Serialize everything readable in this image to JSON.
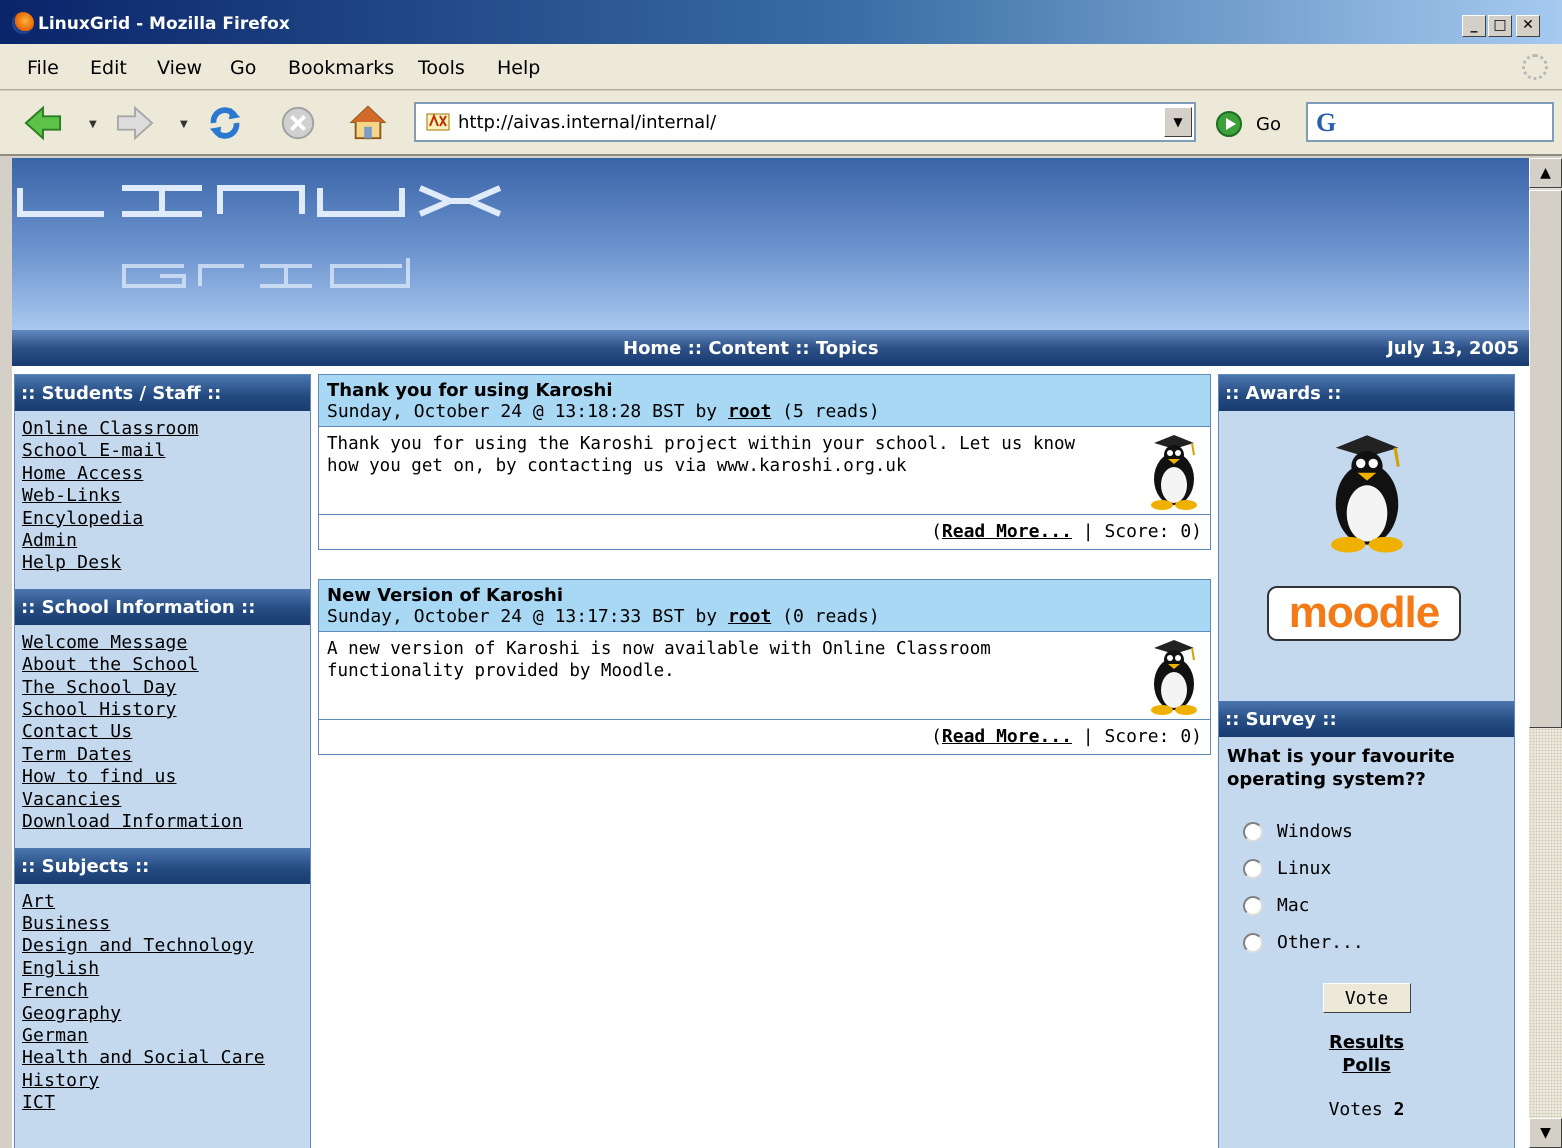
{
  "window": {
    "title": "LinuxGrid - Mozilla Firefox"
  },
  "menu": [
    "File",
    "Edit",
    "View",
    "Go",
    "Bookmarks",
    "Tools",
    "Help"
  ],
  "toolbar": {
    "url": "http://aivas.internal/internal/",
    "go_label": "Go",
    "search_icon": "G"
  },
  "site": {
    "topnav": "Home :: Content :: Topics",
    "date": "July 13, 2005"
  },
  "blocks": {
    "students": {
      "title": ":: Students / Staff ::",
      "links": [
        "Online Classroom",
        "School E-mail",
        "Home Access",
        "Web-Links",
        "Encylopedia",
        "Admin",
        "Help Desk"
      ]
    },
    "school": {
      "title": ":: School Information ::",
      "links": [
        "Welcome Message",
        "About the School",
        "The School Day",
        "School History",
        "Contact Us",
        "Term Dates",
        "How to find us",
        "Vacancies",
        "Download Information"
      ]
    },
    "subjects": {
      "title": ":: Subjects ::",
      "links": [
        "Art",
        "Business",
        "Design and Technology",
        "English",
        "French",
        "Geography",
        "German",
        "Health and Social Care",
        "History",
        "ICT"
      ]
    },
    "awards": {
      "title": ":: Awards ::",
      "moodle_logo": "moodle"
    },
    "survey": {
      "title": ":: Survey ::",
      "question": "What is your favourite operating system??",
      "options": [
        "Windows",
        "Linux",
        "Mac",
        "Other..."
      ],
      "vote": "Vote",
      "results": "Results",
      "polls": "Polls",
      "votes_label": "Votes",
      "votes_count": "2"
    }
  },
  "articles": [
    {
      "title": "Thank you for using Karoshi",
      "meta_pre": "Sunday, October 24 @ 13:18:28 BST by ",
      "author": "root",
      "meta_post": " (5 reads)",
      "body": "Thank you for using the Karoshi project within your school. Let us know how you get on, by contacting us via ",
      "link": "www.karoshi.org.uk",
      "read_more": "Read More...",
      "score": " | Score: 0)"
    },
    {
      "title": "New Version of Karoshi",
      "meta_pre": "Sunday, October 24 @ 13:17:33 BST by ",
      "author": "root",
      "meta_post": " (0 reads)",
      "body": "A new version of Karoshi is now available with Online Classroom functionality provided by Moodle.",
      "link": "",
      "read_more": "Read More...",
      "score": " | Score: 0)"
    }
  ]
}
